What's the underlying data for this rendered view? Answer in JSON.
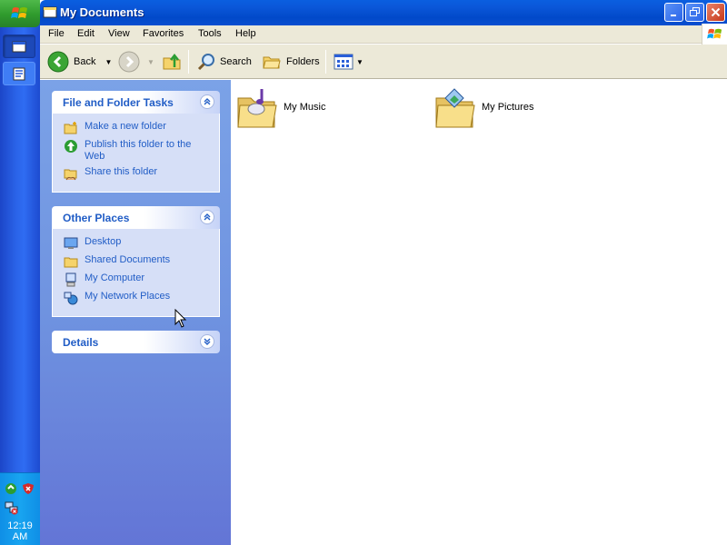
{
  "window": {
    "title": "My Documents"
  },
  "menu": [
    "File",
    "Edit",
    "View",
    "Favorites",
    "Tools",
    "Help"
  ],
  "toolbar": {
    "back_label": "Back",
    "search_label": "Search",
    "folders_label": "Folders"
  },
  "tasks_panel": {
    "title": "File and Folder Tasks",
    "items": [
      "Make a new folder",
      "Publish this folder to the Web",
      "Share this folder"
    ]
  },
  "places_panel": {
    "title": "Other Places",
    "items": [
      "Desktop",
      "Shared Documents",
      "My Computer",
      "My Network Places"
    ]
  },
  "details_panel": {
    "title": "Details"
  },
  "content": {
    "items": [
      {
        "name": "My Music",
        "icon": "music-folder-icon"
      },
      {
        "name": "My Pictures",
        "icon": "pictures-folder-icon"
      }
    ]
  },
  "taskbar": {
    "clock": "12:19 AM"
  },
  "colors": {
    "accent": "#215dc6",
    "titlebar": "#0a56d8",
    "taskpane": "#6f93e0"
  }
}
